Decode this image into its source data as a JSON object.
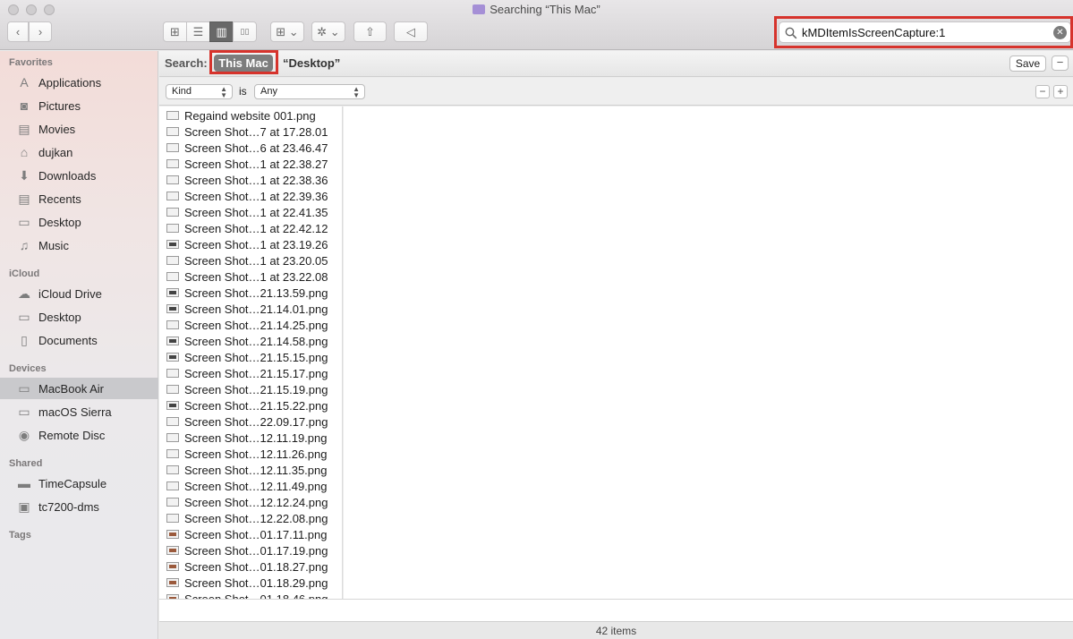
{
  "window": {
    "title": "Searching “This Mac”"
  },
  "toolbar": {
    "back_glyph": "‹",
    "forward_glyph": "›",
    "view_modes": [
      {
        "name": "icon-view",
        "glyph": "⊞"
      },
      {
        "name": "list-view",
        "glyph": "☰"
      },
      {
        "name": "column-view",
        "glyph": "▥"
      },
      {
        "name": "cover-flow-view",
        "glyph": "▯▯"
      }
    ],
    "arrange_glyph": "⊞ ⌄",
    "action_glyph": "✲ ⌄",
    "share_glyph": "⇧",
    "tag_glyph": "◁"
  },
  "search": {
    "query": "kMDItemIsScreenCapture:1",
    "clear_glyph": "✕"
  },
  "scope": {
    "label": "Search:",
    "this_mac": "This Mac",
    "desktop": "“Desktop”",
    "save": "Save",
    "minus": "−"
  },
  "criteria": {
    "attribute": "Kind",
    "operator": "is",
    "value": "Any",
    "minus": "−",
    "plus": "+"
  },
  "sidebar": {
    "favorites_head": "Favorites",
    "favorites": [
      {
        "label": "Applications",
        "icon": "applications-icon",
        "glyph": "A"
      },
      {
        "label": "Pictures",
        "icon": "camera-icon",
        "glyph": "◙"
      },
      {
        "label": "Movies",
        "icon": "film-icon",
        "glyph": "▤"
      },
      {
        "label": "dujkan",
        "icon": "home-icon",
        "glyph": "⌂"
      },
      {
        "label": "Downloads",
        "icon": "download-icon",
        "glyph": "⬇"
      },
      {
        "label": "Recents",
        "icon": "recents-icon",
        "glyph": "▤"
      },
      {
        "label": "Desktop",
        "icon": "desktop-icon",
        "glyph": "▭"
      },
      {
        "label": "Music",
        "icon": "music-icon",
        "glyph": "♫"
      }
    ],
    "icloud_head": "iCloud",
    "icloud": [
      {
        "label": "iCloud Drive",
        "icon": "cloud-icon",
        "glyph": "☁"
      },
      {
        "label": "Desktop",
        "icon": "desktop-icon",
        "glyph": "▭"
      },
      {
        "label": "Documents",
        "icon": "document-icon",
        "glyph": "▯"
      }
    ],
    "devices_head": "Devices",
    "devices": [
      {
        "label": "MacBook Air",
        "icon": "laptop-icon",
        "glyph": "▭",
        "selected": true
      },
      {
        "label": "macOS Sierra",
        "icon": "disk-icon",
        "glyph": "▭"
      },
      {
        "label": "Remote Disc",
        "icon": "disc-icon",
        "glyph": "◉"
      }
    ],
    "shared_head": "Shared",
    "shared": [
      {
        "label": "TimeCapsule",
        "icon": "time-capsule-icon",
        "glyph": "▬"
      },
      {
        "label": "tc7200-dms",
        "icon": "monitor-icon",
        "glyph": "▣"
      }
    ],
    "tags_head": "Tags"
  },
  "files": [
    {
      "name": "Regaind website 001.png",
      "icon": "plain"
    },
    {
      "name": "Screen Shot…7 at 17.28.01",
      "icon": "plain"
    },
    {
      "name": "Screen Shot…6 at 23.46.47",
      "icon": "plain"
    },
    {
      "name": "Screen Shot…1 at 22.38.27",
      "icon": "plain"
    },
    {
      "name": "Screen Shot…1 at 22.38.36",
      "icon": "plain"
    },
    {
      "name": "Screen Shot…1 at 22.39.36",
      "icon": "plain"
    },
    {
      "name": "Screen Shot…1 at 22.41.35",
      "icon": "plain"
    },
    {
      "name": "Screen Shot…1 at 22.42.12",
      "icon": "plain"
    },
    {
      "name": "Screen Shot…1 at 23.19.26",
      "icon": "dark"
    },
    {
      "name": "Screen Shot…1 at 23.20.05",
      "icon": "plain"
    },
    {
      "name": "Screen Shot…1 at 23.22.08",
      "icon": "plain"
    },
    {
      "name": "Screen Shot…21.13.59.png",
      "icon": "dark"
    },
    {
      "name": "Screen Shot…21.14.01.png",
      "icon": "dark"
    },
    {
      "name": "Screen Shot…21.14.25.png",
      "icon": "plain"
    },
    {
      "name": "Screen Shot…21.14.58.png",
      "icon": "dark"
    },
    {
      "name": "Screen Shot…21.15.15.png",
      "icon": "dark"
    },
    {
      "name": "Screen Shot…21.15.17.png",
      "icon": "plain"
    },
    {
      "name": "Screen Shot…21.15.19.png",
      "icon": "plain"
    },
    {
      "name": "Screen Shot…21.15.22.png",
      "icon": "dark"
    },
    {
      "name": "Screen Shot…22.09.17.png",
      "icon": "plain"
    },
    {
      "name": "Screen Shot…12.11.19.png",
      "icon": "plain"
    },
    {
      "name": "Screen Shot…12.11.26.png",
      "icon": "plain"
    },
    {
      "name": "Screen Shot…12.11.35.png",
      "icon": "plain"
    },
    {
      "name": "Screen Shot…12.11.49.png",
      "icon": "plain"
    },
    {
      "name": "Screen Shot…12.12.24.png",
      "icon": "plain"
    },
    {
      "name": "Screen Shot…12.22.08.png",
      "icon": "plain"
    },
    {
      "name": "Screen Shot…01.17.11.png",
      "icon": "img"
    },
    {
      "name": "Screen Shot…01.17.19.png",
      "icon": "img"
    },
    {
      "name": "Screen Shot…01.18.27.png",
      "icon": "img"
    },
    {
      "name": "Screen Shot…01.18.29.png",
      "icon": "img"
    },
    {
      "name": "Screen Shot…01.18.46.png",
      "icon": "img"
    }
  ],
  "status": {
    "count": "42 items"
  },
  "colors": {
    "highlight": "#d6332c",
    "selected_sidebar": "#c9c9cc",
    "this_mac_bg": "#7d7d7d"
  }
}
